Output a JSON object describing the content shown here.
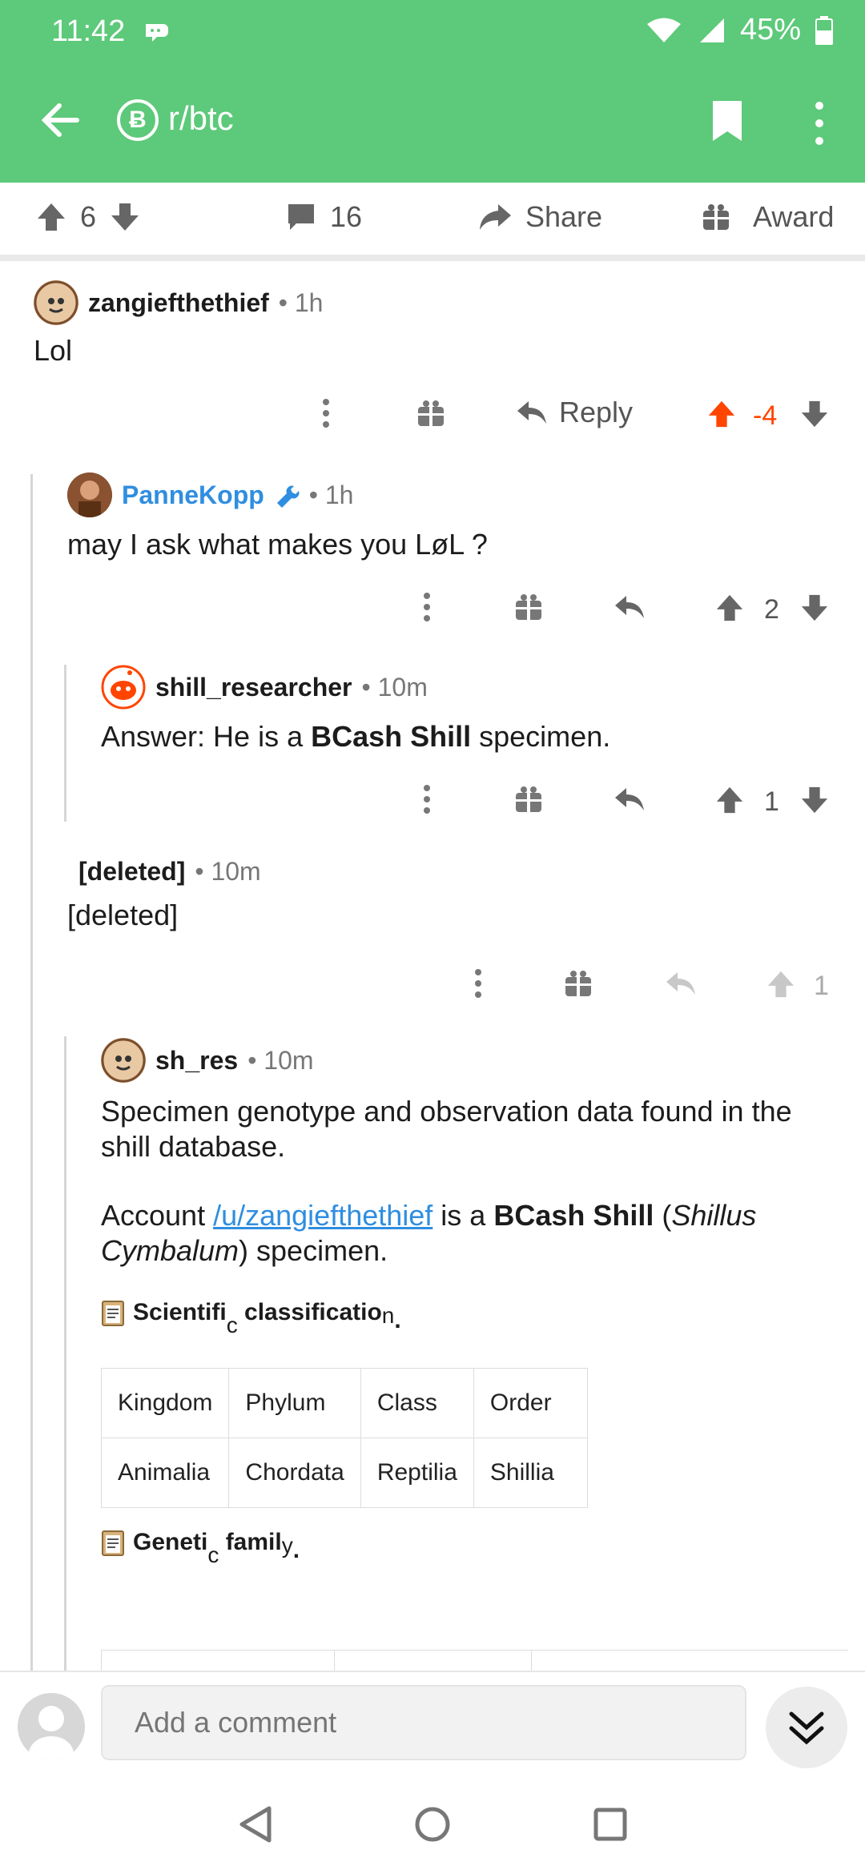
{
  "status_bar": {
    "time": "11:42",
    "battery": "45%"
  },
  "app_bar": {
    "subreddit": "r/btc",
    "subreddit_icon": "Ƀ"
  },
  "post_actions": {
    "upvotes": "6",
    "comments": "16",
    "share_label": "Share",
    "award_label": "Award"
  },
  "comments": [
    {
      "user": "zangiefthethief",
      "time": "1h",
      "body": "Lol",
      "score": "-4",
      "reply_label": "Reply"
    },
    {
      "user": "PanneKopp",
      "time": "1h",
      "body": "may I ask what makes you LøL ?",
      "score": "2"
    },
    {
      "user": "shill_researcher",
      "time": "10m",
      "body_prefix": "Answer: He is a ",
      "body_bold": "BCash Shill",
      "body_suffix": " specimen.",
      "score": "1"
    },
    {
      "user": "[deleted]",
      "time": "10m",
      "body": "[deleted]",
      "score": "1"
    },
    {
      "user": "sh_res",
      "time": "10m",
      "para1": "Specimen genotype and observation data found in the shill database.",
      "para2_prefix": "Account ",
      "para2_link": "/u/zangiefthethief",
      "para2_mid": " is a ",
      "para2_bold": "BCash Shill",
      "para2_open": " (",
      "para2_italic": "Shillus Cymbalum",
      "para2_suffix": ") specimen.",
      "sci_heading_a": "Scientifi",
      "sci_heading_b": "c",
      "sci_heading_c": " classificatio",
      "sci_heading_d": "n",
      "sci_heading_e": ".",
      "table": {
        "header": [
          "Kingdom",
          "Phylum",
          "Class",
          "Order"
        ],
        "row": [
          "Animalia",
          "Chordata",
          "Reptilia",
          "Shillia"
        ]
      },
      "gen_heading_a": "Geneti",
      "gen_heading_b": "c",
      "gen_heading_c": " famil",
      "gen_heading_d": "y",
      "gen_heading_e": "."
    }
  ],
  "composer": {
    "placeholder": "Add a comment"
  },
  "colors": {
    "brand": "#5dc97a",
    "upvote_active": "#ff4500",
    "link": "#2f8ee0"
  }
}
